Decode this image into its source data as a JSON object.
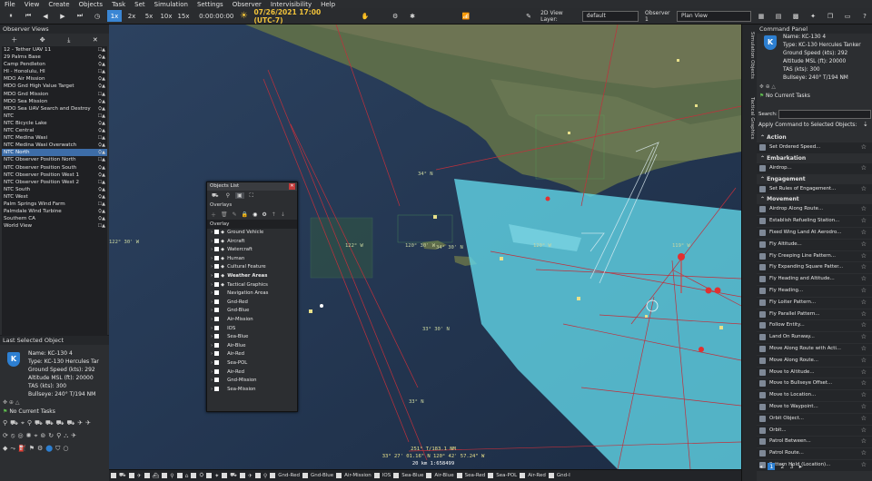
{
  "menu": [
    "File",
    "View",
    "Create",
    "Objects",
    "Task",
    "Set",
    "Simulation",
    "Settings",
    "Observer",
    "Intervisibility",
    "Help"
  ],
  "toolbar": {
    "speeds": [
      "1x",
      "2x",
      "5x",
      "10x",
      "15x"
    ],
    "elapsed": "0:00:00:00",
    "datetime": "07/26/2021 17:00 (UTC-7)",
    "layer_label": "2D View Layer:",
    "layer_value": "default",
    "observer_label": "Observer 1",
    "observer_value": "Plan View"
  },
  "observer_views": {
    "title": "Observer Views",
    "items": [
      "12 - Tether UAV 11",
      "29 Palms Base",
      "Camp Pendleton",
      "HI - Honolulu, HI",
      "MDO Air Mission",
      "MDO Gnd High Value Target",
      "MDO Gnd Mission",
      "MDO Sea Mission",
      "MDO Sea UAV Search and Destroy",
      "NTC",
      "NTC Bicycle Lake",
      "NTC Central",
      "NTC Medina Wasi",
      "NTC Medina Wasi Overwatch",
      "NTC North",
      "NTC Observer Position North",
      "NTC Observer Position South",
      "NTC Observer Position West 1",
      "NTC Observer Position West 2",
      "NTC South",
      "NTC West",
      "Palm Springs Wind Farm",
      "Palmdale Wind Turbine",
      "Southern CA",
      "World View"
    ],
    "selected": "NTC North"
  },
  "last_selected": {
    "title": "Last Selected Object",
    "badge": "K",
    "name": "Name: KC-130 4",
    "type": "Type: KC-130 Hercules Tar",
    "speed": "Ground Speed (kts): 292",
    "alt": "Altitude MSL (ft): 20000",
    "tas": "TAS (kts): 300",
    "bullseye": "Bullseye: 240° T/194 NM",
    "tasks": "No Current Tasks"
  },
  "objects_list": {
    "title": "Objects List",
    "subtitle": "Overlays",
    "overlay_header": "Overlay",
    "rows": [
      {
        "label": "Ground Vehicle",
        "bold": false
      },
      {
        "label": "Aircraft",
        "bold": false
      },
      {
        "label": "Watercraft",
        "bold": false
      },
      {
        "label": "Human",
        "bold": false
      },
      {
        "label": "Cultural Feature",
        "bold": false
      },
      {
        "label": "Weather Areas",
        "bold": true
      },
      {
        "label": "Tactical Graphics",
        "bold": false
      },
      {
        "label": "Navigation Areas",
        "bold": false
      },
      {
        "label": "Gnd-Red",
        "bold": false
      },
      {
        "label": "Gnd-Blue",
        "bold": false
      },
      {
        "label": "Air-Mission",
        "bold": false
      },
      {
        "label": "IOS",
        "bold": false
      },
      {
        "label": "Sea-Blue",
        "bold": false
      },
      {
        "label": "Air-Blue",
        "bold": false
      },
      {
        "label": "Air-Red",
        "bold": false
      },
      {
        "label": "Sea-POL",
        "bold": false
      },
      {
        "label": "Air-Red",
        "bold": false
      },
      {
        "label": "Gnd-Mission",
        "bold": false
      },
      {
        "label": "Sea-Mission",
        "bold": false
      }
    ]
  },
  "map": {
    "labels": [
      "122° 30' W",
      "122° W",
      "120° 30' W",
      "34° N",
      "34° 30' N",
      "33° 30' N",
      "33° N",
      "120° W",
      "119° W"
    ],
    "readout": [
      "251° T/183.1 NM",
      "33° 27' 01.16\" N  120° 42' 57.24\" W"
    ],
    "scale": "20 km  1:658499"
  },
  "side_tabs": [
    "Simulation Objects",
    "Tactical Graphics"
  ],
  "command_panel": {
    "title": "Command Panel",
    "badge": "K",
    "name": "Name: KC-130 4",
    "type": "Type: KC-130 Hercules Tanker",
    "speed": "Ground Speed (kts): 292",
    "alt": "Altitude MSL (ft): 20000",
    "tas": "TAS (kts): 300",
    "bullseye": "Bullseye: 240° T/194 NM",
    "tasks": "No Current Tasks",
    "search_label": "Search:",
    "apply_label": "Apply Command to Selected Objects:",
    "categories": [
      {
        "name": "Action",
        "items": [
          "Set Ordered Speed..."
        ]
      },
      {
        "name": "Embarkation",
        "items": [
          "Airdrop..."
        ]
      },
      {
        "name": "Engagement",
        "items": [
          "Set Rules of Engagement..."
        ]
      },
      {
        "name": "Movement",
        "items": [
          "Airdrop Along Route...",
          "Establish Refueling Station...",
          "Fixed Wing Land At Aerodro...",
          "Fly Altitude...",
          "Fly Creeping Line Pattern...",
          "Fly Expanding Square Patter...",
          "Fly Heading and Altitude...",
          "Fly Heading...",
          "Fly Loiter Pattern...",
          "Fly Parallel Pattern...",
          "Follow Entity...",
          "Land On Runway...",
          "Move Along Route with Acti...",
          "Move Along Route...",
          "Move to Altitude...",
          "Move to Bullseye Offset...",
          "Move to Location...",
          "Move to Waypoint...",
          "Orbit Object...",
          "Orbit...",
          "Patrol Between...",
          "Patrol Route...",
          "Pattern Hold (Location)..."
        ]
      }
    ],
    "pages": [
      "1",
      "2",
      "3"
    ]
  },
  "bottom_bar": [
    "Gnd-Red",
    "Gnd-Blue",
    "Air-Mission",
    "IOS",
    "Sea-Blue",
    "Air-Blue",
    "Sea-Red",
    "Sea-POL",
    "Air-Red",
    "Gnd-I"
  ],
  "colors": {
    "accent": "#2d7fd1",
    "weather_area": "#63d9ea",
    "route": "#c0303c",
    "date": "#f2c33a"
  }
}
